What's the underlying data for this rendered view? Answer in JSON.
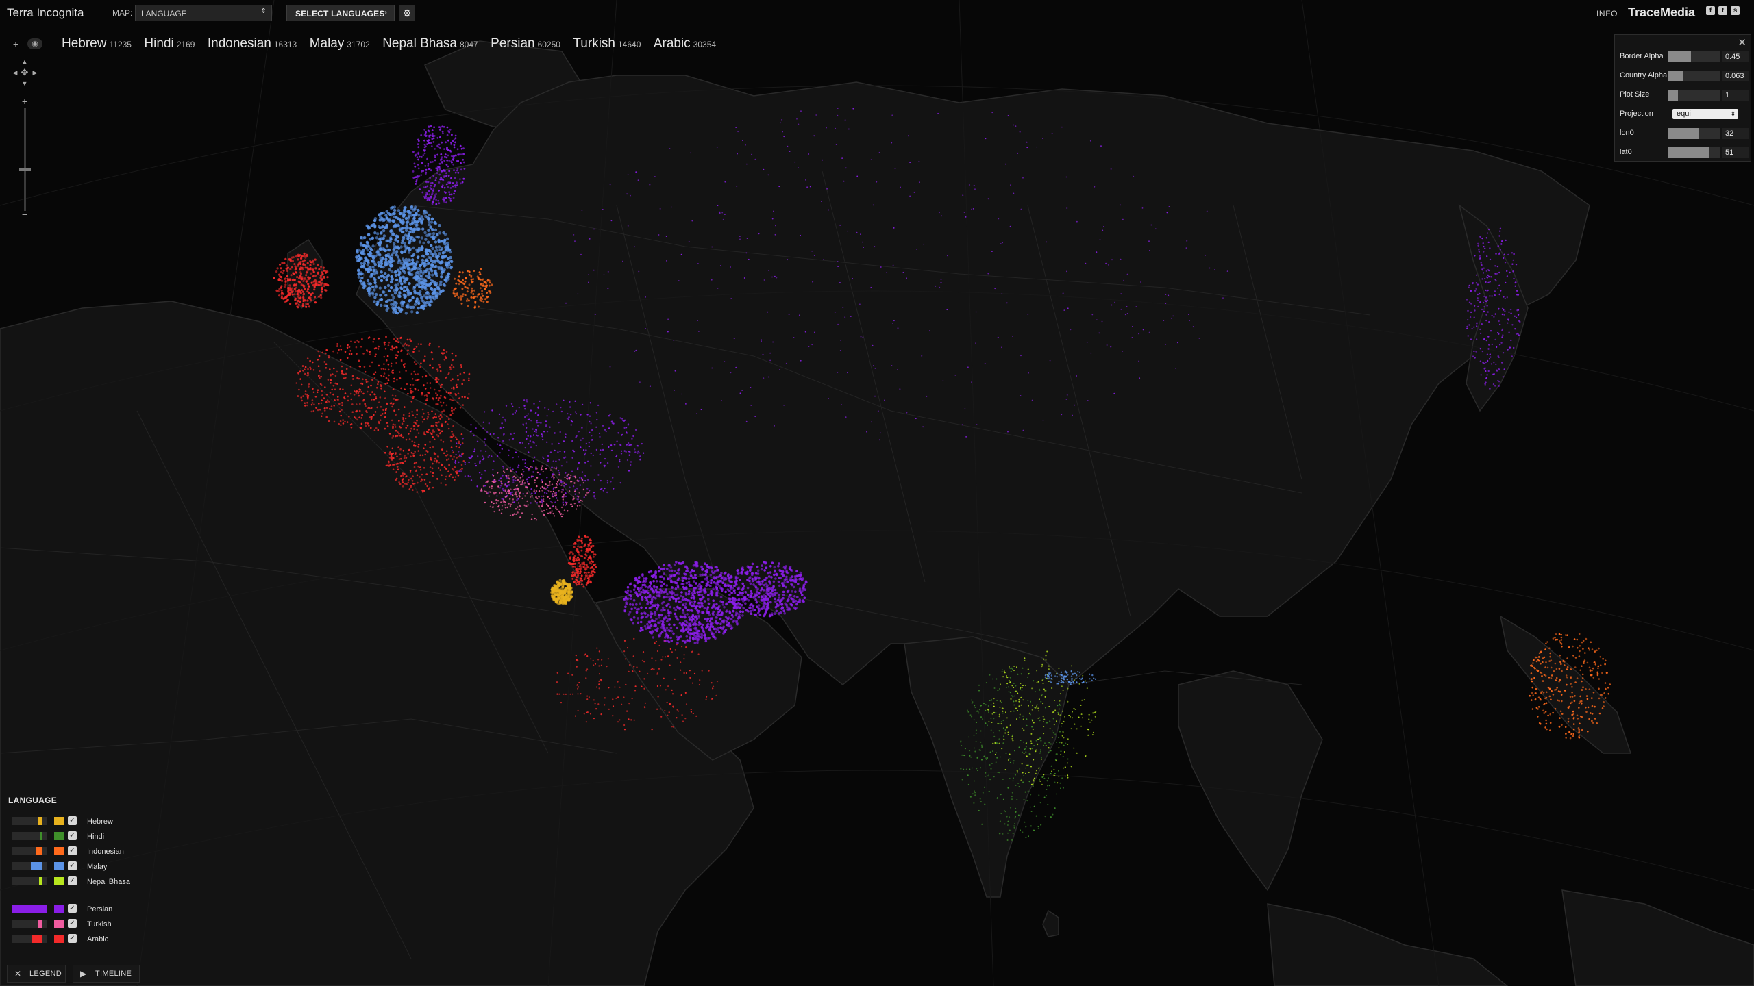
{
  "app": {
    "title": "Terra Incognita",
    "map_label": "MAP:",
    "map_value": "LANGUAGE",
    "select_languages": "SELECT LANGUAGES",
    "info": "INFO",
    "brand": "TraceMedia"
  },
  "counts": [
    {
      "name": "Hebrew",
      "value": "11235"
    },
    {
      "name": "Hindi",
      "value": "2169"
    },
    {
      "name": "Indonesian",
      "value": "16313"
    },
    {
      "name": "Malay",
      "value": "31702"
    },
    {
      "name": "Nepal Bhasa",
      "value": "8047"
    },
    {
      "name": "Persian",
      "value": "60250"
    },
    {
      "name": "Turkish",
      "value": "14640"
    },
    {
      "name": "Arabic",
      "value": "30354"
    }
  ],
  "settings": {
    "border_alpha": {
      "label": "Border Alpha",
      "value": "0.45",
      "level": 0.45
    },
    "country_alpha": {
      "label": "Country Alpha",
      "value": "0.063",
      "level": 0.3
    },
    "plot_size": {
      "label": "Plot Size",
      "value": "1",
      "level": 0.2
    },
    "projection": {
      "label": "Projection",
      "value": "equi"
    },
    "lon0": {
      "label": "lon0",
      "value": "32",
      "level": 0.6
    },
    "lat0": {
      "label": "lat0",
      "value": "51",
      "level": 0.8
    }
  },
  "legend": {
    "title": "LANGUAGE",
    "items": [
      {
        "name": "Hebrew",
        "color": "#e8b21e",
        "share": 0.15
      },
      {
        "name": "Hindi",
        "color": "#3f8f2a",
        "share": 0.03
      },
      {
        "name": "Indonesian",
        "color": "#ff6a1c",
        "share": 0.2
      },
      {
        "name": "Malay",
        "color": "#5b93e6",
        "share": 0.35
      },
      {
        "name": "Nepal Bhasa",
        "color": "#b8e61e",
        "share": 0.1
      },
      {
        "name": "Persian",
        "color": "#8a1ee8",
        "share": 1.0
      },
      {
        "name": "Turkish",
        "color": "#f05ca0",
        "share": 0.15
      },
      {
        "name": "Arabic",
        "color": "#f22a2a",
        "share": 0.3
      }
    ]
  },
  "bottom": {
    "legend_label": "LEGEND",
    "timeline_label": "TIMELINE"
  }
}
